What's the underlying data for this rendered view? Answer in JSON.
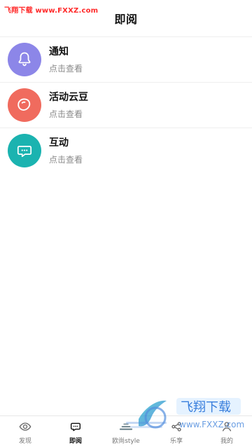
{
  "watermark": {
    "top_text": "飞翔下载 www.FXXZ.com",
    "bottom_brand": "飞翔下载",
    "bottom_url": "www.FXXZ.com"
  },
  "header": {
    "title": "即阅"
  },
  "list": {
    "items": [
      {
        "title": "通知",
        "subtitle": "点击查看",
        "icon": "bell-icon",
        "color": "#8c86e8"
      },
      {
        "title": "活动云豆",
        "subtitle": "点击查看",
        "icon": "bean-icon",
        "color": "#f06b5e"
      },
      {
        "title": "互动",
        "subtitle": "点击查看",
        "icon": "chat-bubble-icon",
        "color": "#1bb3b0"
      }
    ]
  },
  "bottom_nav": {
    "items": [
      {
        "label": "发现",
        "icon": "eye-icon"
      },
      {
        "label": "即阅",
        "icon": "chat-dots-icon",
        "active": true
      },
      {
        "label": "欧尚style",
        "icon": "style-icon"
      },
      {
        "label": "乐享",
        "icon": "share-icon"
      },
      {
        "label": "我的",
        "icon": "user-icon"
      }
    ]
  }
}
